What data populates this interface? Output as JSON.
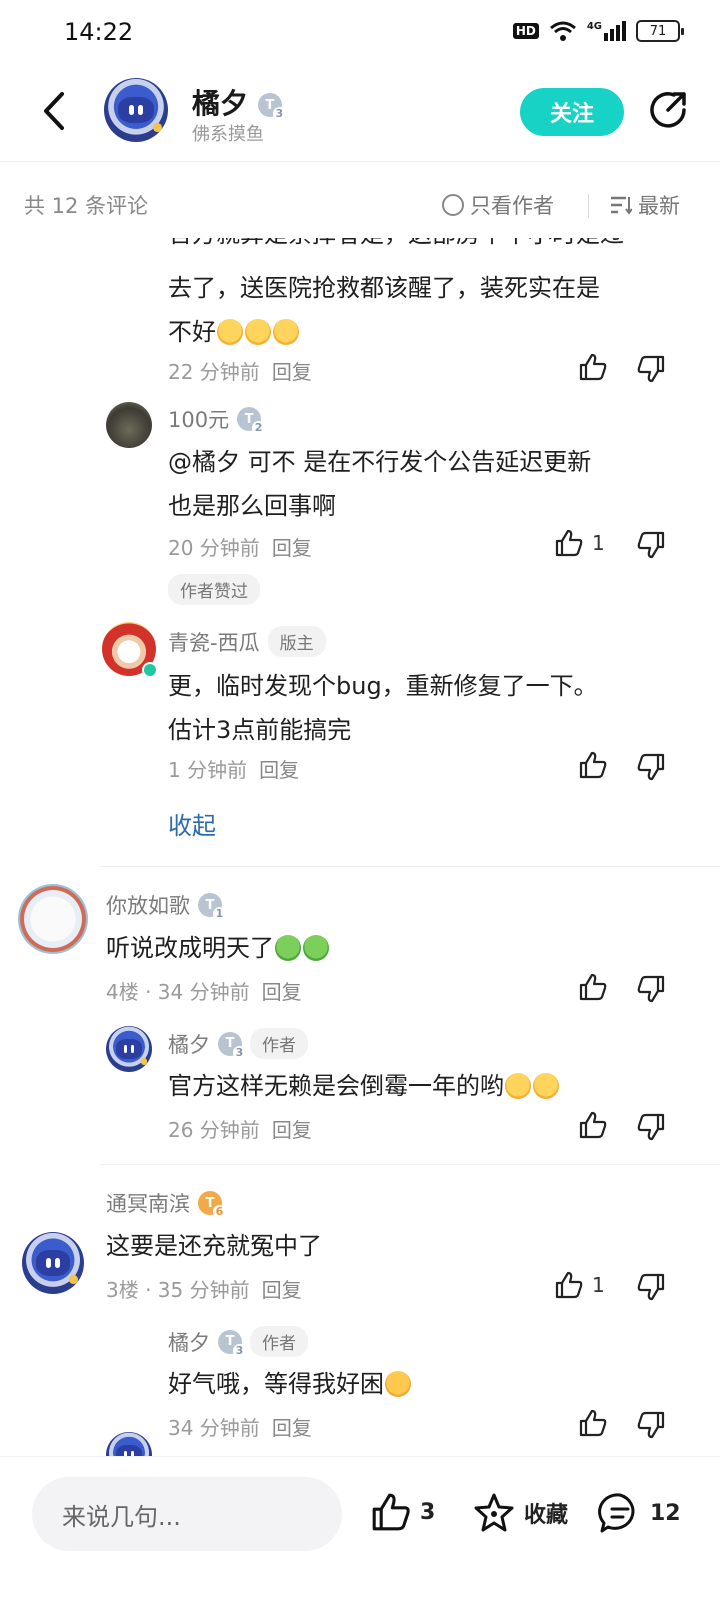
{
  "status_bar": {
    "time": "14:22",
    "hd": "HD",
    "signal": "4G",
    "battery": "71"
  },
  "header": {
    "name": "橘夕",
    "level": "3",
    "subtitle": "佛系摸鱼",
    "follow_label": "关注"
  },
  "filter_bar": {
    "count": "共 12 条评论",
    "only_author": "只看作者",
    "sort": "最新"
  },
  "partial_reply": {
    "cut_line": "官方就算是禁掉者是，这部房午半小时是过",
    "text_lines": [
      "去了，送医院抢救都该醒了，装死实在是",
      "不好"
    ],
    "time": "22 分钟前",
    "reply": "回复"
  },
  "reply_100": {
    "user": "100元",
    "level": "2",
    "text_lines": [
      "@橘夕  可不 是在不行发个公告延迟更新",
      "也是那么回事啊"
    ],
    "time": "20 分钟前",
    "reply": "回复",
    "likes": "1",
    "badge": "作者赞过"
  },
  "reply_mod": {
    "user": "青瓷-西瓜",
    "role": "版主",
    "text_lines": [
      "更，临时发现个bug，重新修复了一下。",
      "估计3点前能搞完"
    ],
    "time": "1 分钟前",
    "reply": "回复"
  },
  "collapse_label": "收起",
  "comment_4": {
    "user": "你放如歌",
    "level": "1",
    "text": "听说改成明天了",
    "floor": "4楼 · 34 分钟前",
    "reply": "回复"
  },
  "comment_4_reply": {
    "user": "橘夕",
    "level": "3",
    "role": "作者",
    "text": "官方这样无赖是会倒霉一年的哟",
    "time": "26 分钟前",
    "reply": "回复"
  },
  "comment_3": {
    "user": "通冥南滨",
    "level": "6",
    "text": "这要是还充就冤中了",
    "floor": "3楼 · 35 分钟前",
    "reply": "回复",
    "likes": "1"
  },
  "comment_3_reply": {
    "user": "橘夕",
    "level": "3",
    "role": "作者",
    "text": "好气哦，等得我好困",
    "time": "34 分钟前",
    "reply": "回复"
  },
  "bottom_bar": {
    "placeholder": "来说几句...",
    "likes": "3",
    "favorite": "收藏",
    "comments": "12"
  }
}
